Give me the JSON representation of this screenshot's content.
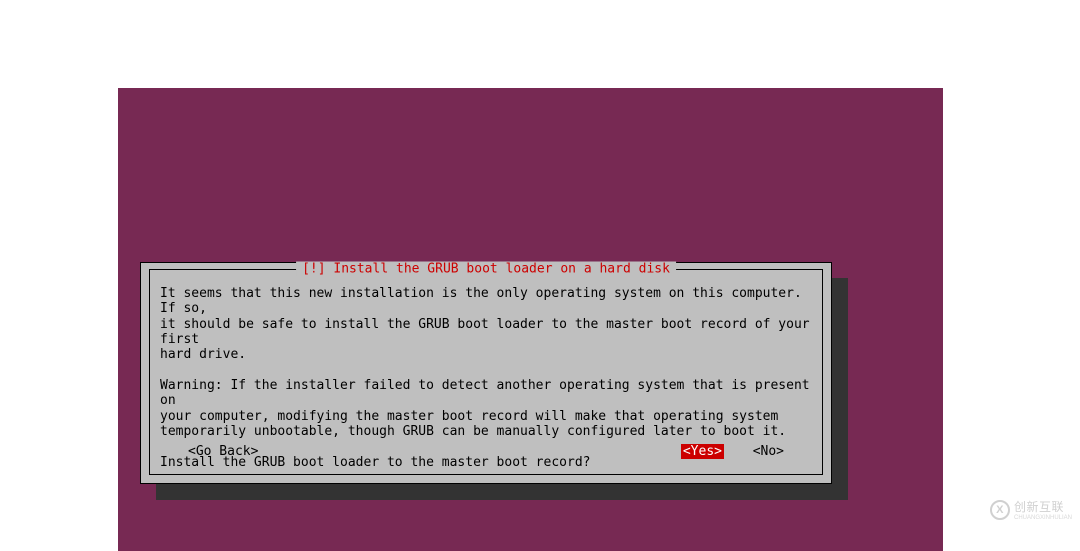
{
  "colors": {
    "background": "#772953",
    "dialog_bg": "#bfbfbf",
    "title_fg": "#cc0000",
    "highlight_bg": "#cc0000",
    "highlight_fg": "#ffffff"
  },
  "dialog": {
    "title": "[!] Install the GRUB boot loader on a hard disk",
    "paragraph1": "It seems that this new installation is the only operating system on this computer. If so,\nit should be safe to install the GRUB boot loader to the master boot record of your first\nhard drive.",
    "paragraph2": "Warning: If the installer failed to detect another operating system that is present on\nyour computer, modifying the master boot record will make that operating system\ntemporarily unbootable, though GRUB can be manually configured later to boot it.",
    "question": "Install the GRUB boot loader to the master boot record?",
    "buttons": {
      "go_back": "<Go Back>",
      "yes": "<Yes>",
      "no": "<No>",
      "selected": "yes"
    }
  },
  "watermark": {
    "icon_letter": "X",
    "text": "创新互联",
    "sub": "CHUANGXINHULIAN"
  }
}
